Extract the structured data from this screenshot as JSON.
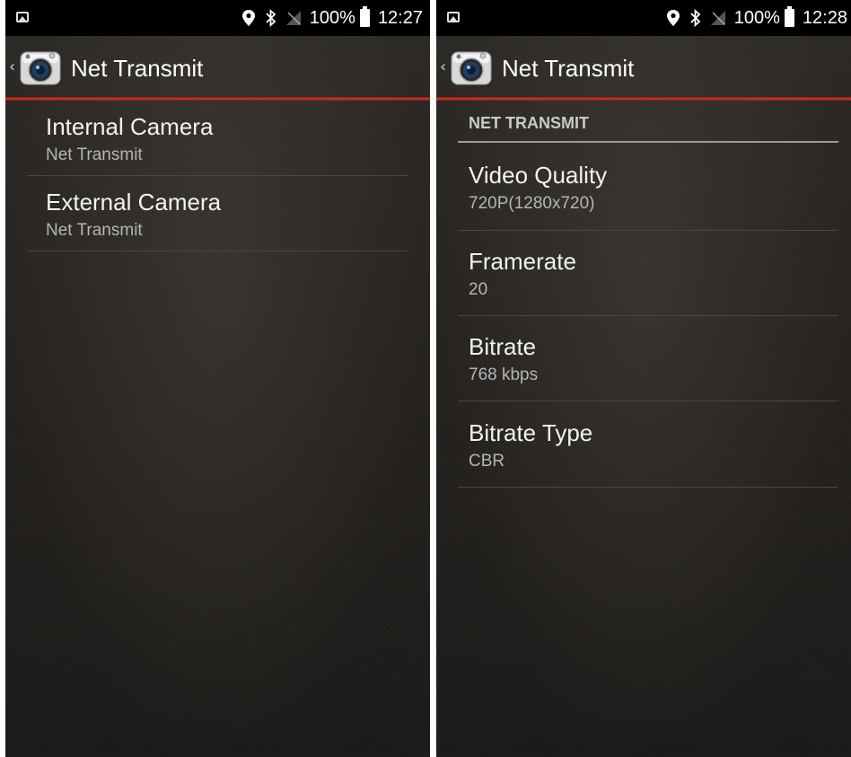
{
  "left": {
    "status": {
      "battery": "100%",
      "time": "12:27"
    },
    "title": "Net Transmit",
    "items": [
      {
        "title": "Internal Camera",
        "summary": "Net Transmit"
      },
      {
        "title": "External Camera",
        "summary": "Net Transmit"
      }
    ]
  },
  "right": {
    "status": {
      "battery": "100%",
      "time": "12:28"
    },
    "title": "Net Transmit",
    "section": "NET TRANSMIT",
    "items": [
      {
        "title": "Video Quality",
        "summary": "720P(1280x720)"
      },
      {
        "title": "Framerate",
        "summary": "20"
      },
      {
        "title": "Bitrate",
        "summary": "768 kbps"
      },
      {
        "title": "Bitrate Type",
        "summary": "CBR"
      }
    ]
  },
  "colors": {
    "accent_line": "#d23a23",
    "statusbar": "#000000"
  },
  "icons": [
    "image-icon",
    "location-icon",
    "bluetooth-icon",
    "no-sim-icon",
    "battery-icon",
    "back-chevron-icon",
    "camera-app-icon"
  ]
}
